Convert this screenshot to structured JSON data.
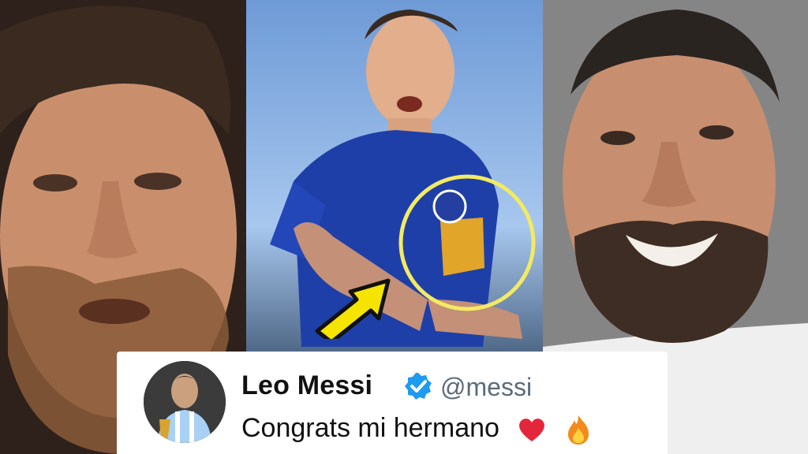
{
  "tweet": {
    "display_name": "Leo Messi",
    "handle": "@messi",
    "text": "Congrats mi hermano",
    "emojis": [
      "heart-emoji",
      "fire-emoji"
    ]
  },
  "colors": {
    "verified_badge": "#1d9bf0",
    "highlight_circle": "#f3ea63",
    "arrow_fill": "#f5e400",
    "jersey": "#1f3fa8"
  },
  "icons": [
    "verified-badge-icon",
    "arrow-icon",
    "highlight-circle"
  ]
}
